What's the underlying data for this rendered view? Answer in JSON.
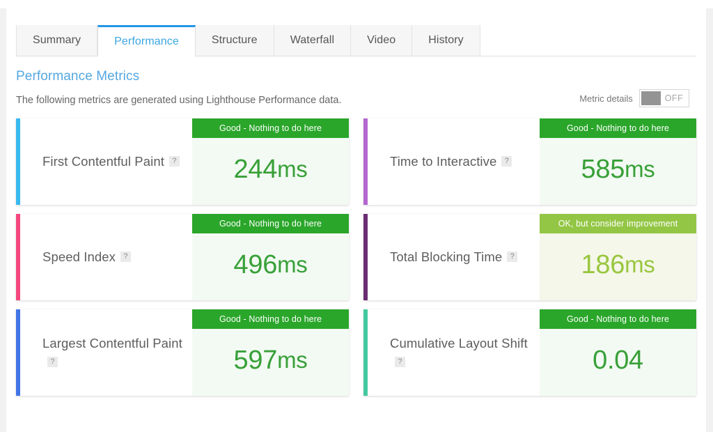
{
  "tabs": [
    {
      "label": "Summary",
      "active": false
    },
    {
      "label": "Performance",
      "active": true
    },
    {
      "label": "Structure",
      "active": false
    },
    {
      "label": "Waterfall",
      "active": false
    },
    {
      "label": "Video",
      "active": false
    },
    {
      "label": "History",
      "active": false
    }
  ],
  "section": {
    "title": "Performance Metrics",
    "subtitle": "The following metrics are generated using Lighthouse Performance data."
  },
  "metric_details": {
    "label": "Metric details",
    "state": "OFF"
  },
  "help_badge_glyph": "?",
  "status_colors": {
    "good_header": "#2aa62a",
    "good_body": "#f3faf3",
    "good_text": "#38a038",
    "ok_header": "#93c645",
    "ok_body": "#f4f7e9",
    "ok_text": "#99c63f"
  },
  "metrics": [
    {
      "name": "First Contentful Paint",
      "value": "244",
      "unit": "ms",
      "status": "Good - Nothing to do here",
      "status_level": "good",
      "accent": "#39b9ef"
    },
    {
      "name": "Time to Interactive",
      "value": "585",
      "unit": "ms",
      "status": "Good - Nothing to do here",
      "status_level": "good",
      "accent": "#b367cf"
    },
    {
      "name": "Speed Index",
      "value": "496",
      "unit": "ms",
      "status": "Good - Nothing to do here",
      "status_level": "good",
      "accent": "#f4487f"
    },
    {
      "name": "Total Blocking Time",
      "value": "186",
      "unit": "ms",
      "status": "OK, but consider improvement",
      "status_level": "ok",
      "accent": "#6b2d72"
    },
    {
      "name": "Largest Contentful Paint",
      "value": "597",
      "unit": "ms",
      "status": "Good - Nothing to do here",
      "status_level": "good",
      "accent": "#4274e8"
    },
    {
      "name": "Cumulative Layout Shift",
      "value": "0.04",
      "unit": "",
      "status": "Good - Nothing to do here",
      "status_level": "good",
      "accent": "#43c9a0"
    }
  ]
}
